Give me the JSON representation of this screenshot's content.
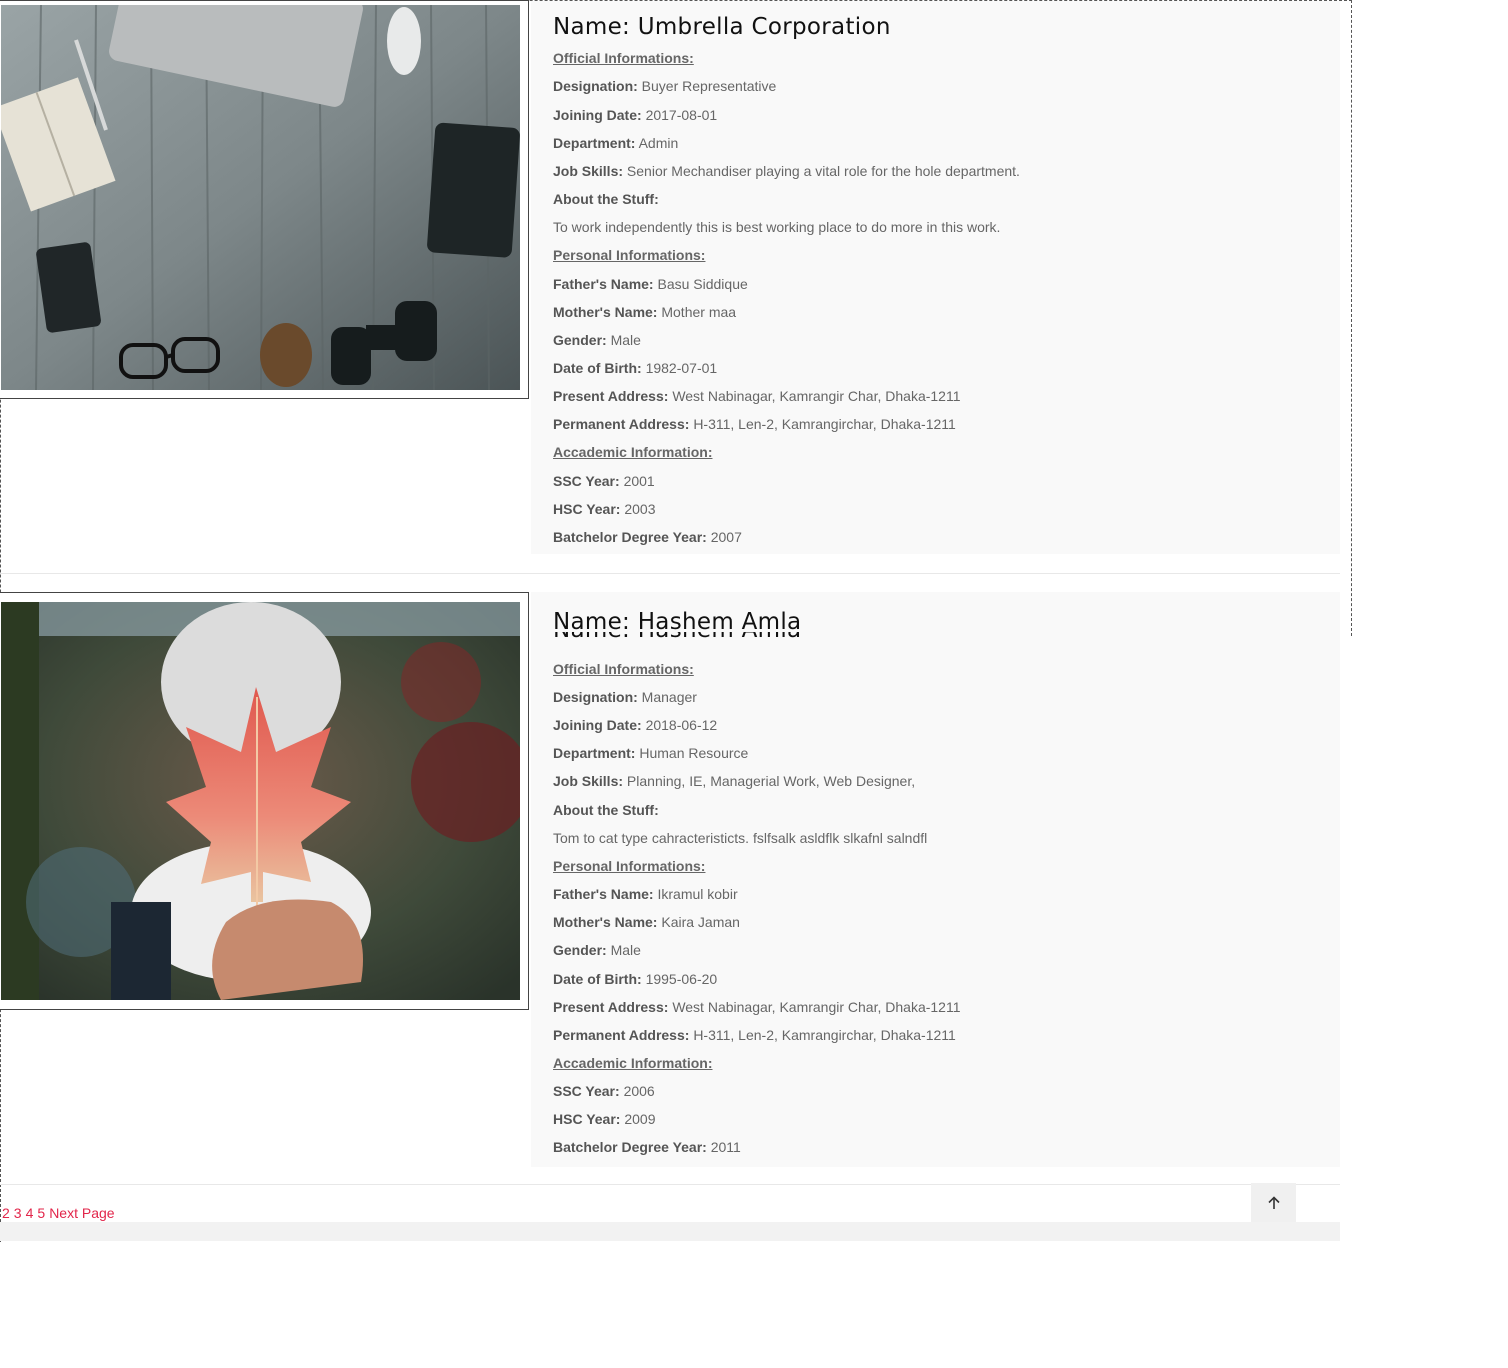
{
  "records": [
    {
      "name": "Name: Umbrella Corporation",
      "official_heading": "Official Informations:",
      "designation_label": "Designation:",
      "designation": "Buyer Representative",
      "joining_label": "Joining Date:",
      "joining": "2017-08-01",
      "department_label": "Department:",
      "department": "Admin",
      "skills_label": "Job Skills:",
      "skills": "Senior Mechandiser playing a vital role for the hole department.",
      "about_label": "About the Stuff:",
      "about": "To work independently this is best working place to do more in this work.",
      "personal_heading": "Personal Informations:",
      "father_label": "Father's Name:",
      "father": "Basu Siddique",
      "mother_label": "Mother's Name:",
      "mother": "Mother maa",
      "gender_label": "Gender:",
      "gender": "Male",
      "dob_label": "Date of Birth:",
      "dob": "1982-07-01",
      "present_label": "Present Address:",
      "present": "West Nabinagar, Kamrangir Char, Dhaka-1211",
      "permanent_label": "Permanent Address:",
      "permanent": "H-311, Len-2, Kamrangirchar, Dhaka-1211",
      "academic_heading": "Accademic Information:",
      "ssc_label": "SSC Year:",
      "ssc": "2001",
      "hsc_label": "HSC Year:",
      "hsc": "2003",
      "bachelor_label": "Batchelor Degree Year:",
      "bachelor": "2007"
    },
    {
      "name": "Name: Hashem Amla",
      "official_heading": "Official Informations:",
      "designation_label": "Designation:",
      "designation": "Manager",
      "joining_label": "Joining Date:",
      "joining": "2018-06-12",
      "department_label": "Department:",
      "department": "Human Resource",
      "skills_label": "Job Skills:",
      "skills": "Planning, IE, Managerial Work, Web Designer,",
      "about_label": "About the Stuff:",
      "about": "Tom to cat type cahracteristicts. fslfsalk asldflk slkafnl salndfl",
      "personal_heading": "Personal Informations:",
      "father_label": "Father's Name:",
      "father": "Ikramul kobir",
      "mother_label": "Mother's Name:",
      "mother": "Kaira Jaman",
      "gender_label": "Gender:",
      "gender": "Male",
      "dob_label": "Date of Birth:",
      "dob": "1995-06-20",
      "present_label": "Present Address:",
      "present": "West Nabinagar, Kamrangir Char, Dhaka-1211",
      "permanent_label": "Permanent Address:",
      "permanent": "H-311, Len-2, Kamrangirchar, Dhaka-1211",
      "academic_heading": "Accademic Information:",
      "ssc_label": "SSC Year:",
      "ssc": "2006",
      "hsc_label": "HSC Year:",
      "hsc": "2009",
      "bachelor_label": "Batchelor Degree Year:",
      "bachelor": "2011"
    }
  ],
  "pagination": {
    "pages": [
      "2",
      "3",
      "4",
      "5"
    ],
    "next_label": "Next Page"
  },
  "icons": {
    "back_to_top": "arrow-up-icon",
    "photo_1": "desk-flatlay-photo",
    "photo_2": "red-leaf-photo"
  },
  "colors": {
    "link": "#e2254a",
    "panel": "#f9f9f9"
  }
}
